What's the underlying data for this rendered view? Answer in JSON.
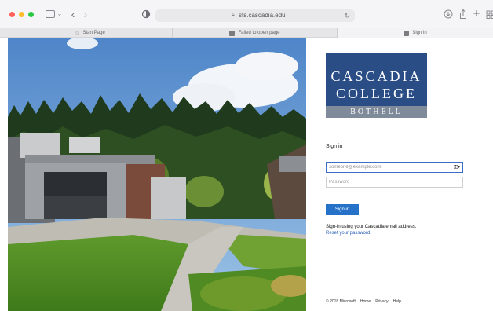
{
  "browser": {
    "url": "sts.cascadia.edu",
    "icons": [
      "sidebar-icon",
      "chevron-down-icon",
      "back-icon",
      "forward-icon",
      "shield-icon",
      "lock-icon",
      "reload-icon",
      "download-icon",
      "share-icon",
      "plus-icon",
      "tab-grid-icon"
    ],
    "tabs": [
      {
        "label": "Start Page"
      },
      {
        "label": "Failed to open page"
      },
      {
        "label": "Sign in"
      }
    ]
  },
  "logo": {
    "line1": "CASCADIA",
    "line2": "COLLEGE",
    "line3": "BOTHELL",
    "brand_color": "#2a4d86"
  },
  "signin": {
    "title": "Sign in",
    "email_placeholder": "someone@example.com",
    "password_placeholder": "Password",
    "button_label": "Sign in",
    "button_color": "#2672c9",
    "help_text": "Sign-in using your Cascadia email address.",
    "reset_link": "Reset your password."
  },
  "footer": {
    "copyright": "© 2018 Microsoft",
    "links": [
      "Home",
      "Privacy",
      "Help"
    ]
  }
}
